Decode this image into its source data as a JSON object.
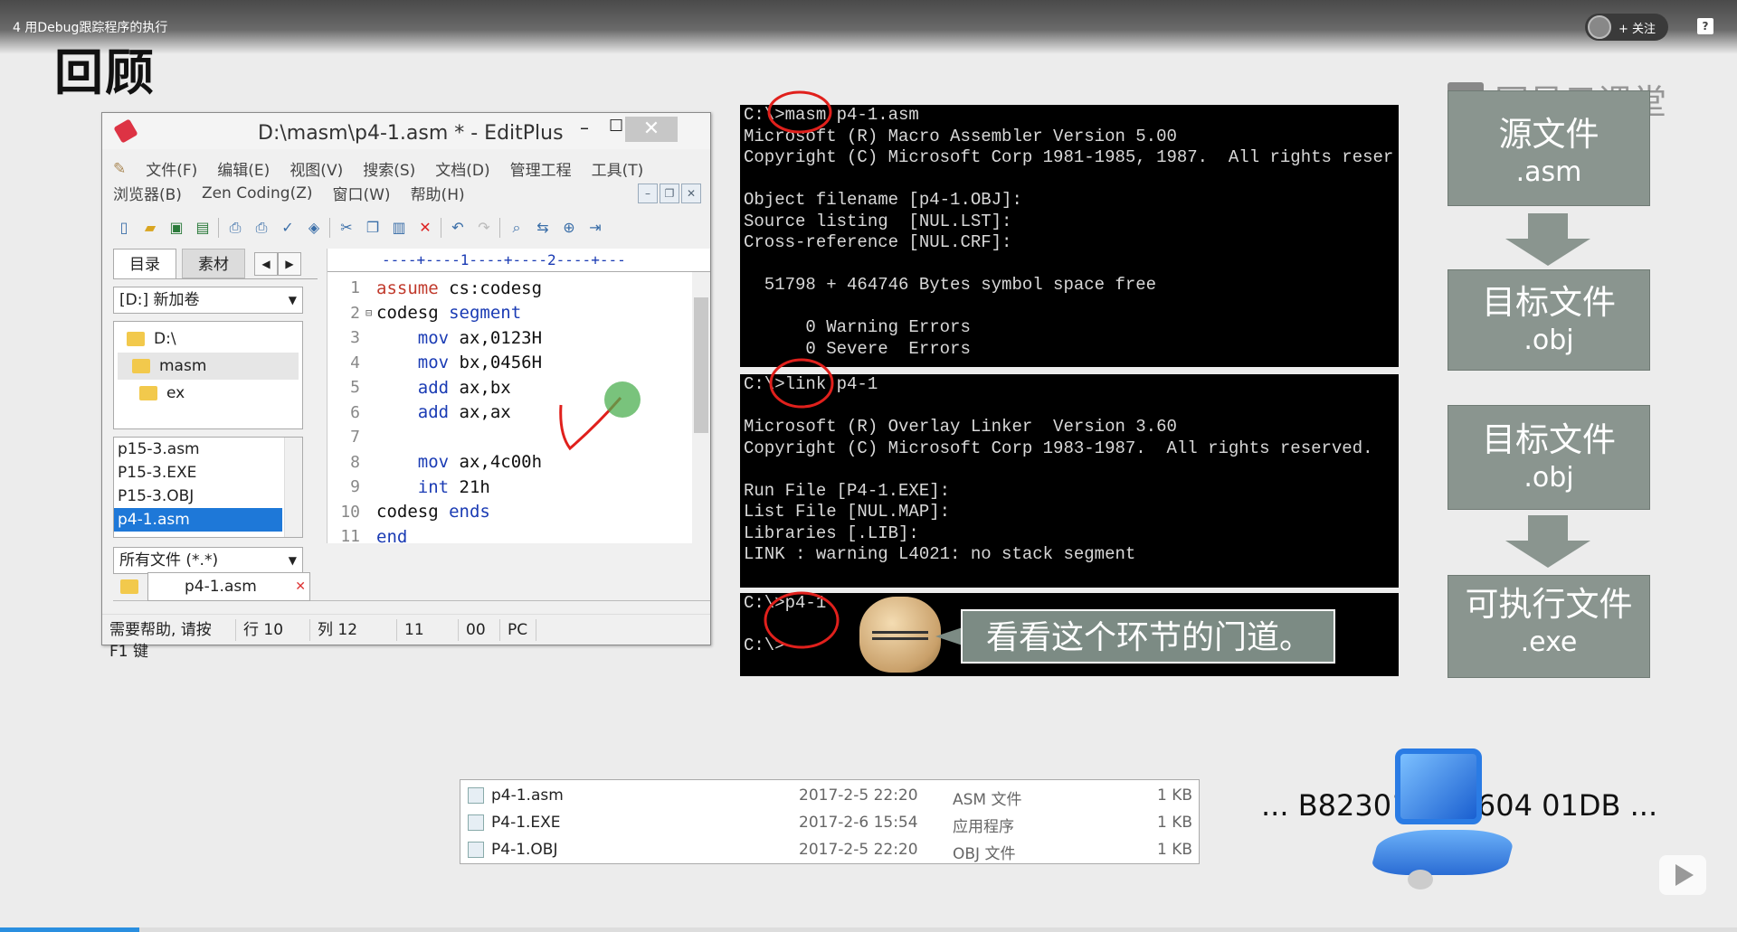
{
  "video": {
    "title": "4 用Debug跟踪程序的执行",
    "follow_label": "+ 关注",
    "help_label": "?",
    "progress": 0.08
  },
  "slide": {
    "title": "回顾",
    "brand": "网易云课堂"
  },
  "editplus": {
    "window_title": "D:\\masm\\p4-1.asm * - EditPlus",
    "minimize": "–",
    "maximize": "☐",
    "close": "✕",
    "menu_row1": [
      "文件(F)",
      "编辑(E)",
      "视图(V)",
      "搜索(S)",
      "文档(D)",
      "管理工程",
      "工具(T)"
    ],
    "menu_row2": [
      "浏览器(B)",
      "Zen Coding(Z)",
      "窗口(W)",
      "帮助(H)"
    ],
    "tab_dir": "目录",
    "tab_clip": "素材",
    "drive": "[D:] 新加卷",
    "dirs": [
      "D:\\",
      "masm",
      "ex"
    ],
    "files": [
      "p15-3.asm",
      "P15-3.EXE",
      "P15-3.OBJ",
      "p4-1.asm"
    ],
    "filter": "所有文件 (*.*)",
    "doc_tab": "p4-1.asm",
    "ruler": "----+----1----+----2----+---",
    "code": [
      {
        "n": "1",
        "fold": "",
        "kw": "assume",
        "kwc": "red",
        "rest": " cs:codesg"
      },
      {
        "n": "2",
        "fold": "⊟",
        "kw": "codesg",
        "kwc": "plain",
        "rest": " segment"
      },
      {
        "n": "3",
        "fold": "",
        "kw": "    mov",
        "kwc": "blue",
        "rest": " ax,0123H"
      },
      {
        "n": "4",
        "fold": "",
        "kw": "    mov",
        "kwc": "blue",
        "rest": " bx,0456H"
      },
      {
        "n": "5",
        "fold": "",
        "kw": "    add",
        "kwc": "blue",
        "rest": " ax,bx"
      },
      {
        "n": "6",
        "fold": "",
        "kw": "    add",
        "kwc": "blue",
        "rest": " ax,ax"
      },
      {
        "n": "7",
        "fold": "",
        "kw": "",
        "kwc": "plain",
        "rest": ""
      },
      {
        "n": "8",
        "fold": "",
        "kw": "    mov",
        "kwc": "blue",
        "rest": " ax,4c00h"
      },
      {
        "n": "9",
        "fold": "",
        "kw": "    int",
        "kwc": "blue",
        "rest": " 21h"
      },
      {
        "n": "10",
        "fold": "",
        "kw": "codesg",
        "kwc": "plain",
        "rest": " ends"
      },
      {
        "n": "11",
        "fold": "",
        "kw": "end",
        "kwc": "blue",
        "rest": ""
      }
    ],
    "status": [
      "需要帮助, 请按 F1 键",
      "行 10",
      "列 12",
      "11",
      "00",
      "PC"
    ]
  },
  "dos1": "C:\\>masm p4-1.asm\nMicrosoft (R) Macro Assembler Version 5.00\nCopyright (C) Microsoft Corp 1981-1985, 1987.  All rights reser\n\nObject filename [p4-1.OBJ]:\nSource listing  [NUL.LST]:\nCross-reference [NUL.CRF]:\n\n  51798 + 464746 Bytes symbol space free\n\n      0 Warning Errors\n      0 Severe  Errors",
  "dos2": "C:\\>link p4-1\n\nMicrosoft (R) Overlay Linker  Version 3.60\nCopyright (C) Microsoft Corp 1983-1987.  All rights reserved.\n\nRun File [P4-1.EXE]:\nList File [NUL.MAP]:\nLibraries [.LIB]:\nLINK : warning L4021: no stack segment",
  "dos3": "C:\\>p4-1\n\nC:\\>",
  "bubble": "看看这个环节的门道。",
  "flow": [
    {
      "zh": "源文件",
      "ext": ".asm"
    },
    {
      "zh": "目标文件",
      "ext": ".obj"
    },
    {
      "zh": "目标文件",
      "ext": ".obj"
    },
    {
      "zh": "可执行文件",
      "ext": ".exe"
    }
  ],
  "explorer": [
    {
      "name": "p4-1.asm",
      "date": "2017-2-5 22:20",
      "type": "ASM 文件",
      "size": "1 KB"
    },
    {
      "name": "P4-1.EXE",
      "date": "2017-2-6 15:54",
      "type": "应用程序",
      "size": "1 KB"
    },
    {
      "name": "P4-1.OBJ",
      "date": "2017-2-5 22:20",
      "type": "OBJ 文件",
      "size": "1 KB"
    }
  ],
  "hexbytes": "... B82301 BB5604 01DB ...",
  "colors": {
    "annotation": "#e0201c",
    "flow_box": "#8a958f",
    "selection": "#1e78d8",
    "keyword_red": "#c0392b",
    "keyword_blue": "#1a3bb4"
  }
}
